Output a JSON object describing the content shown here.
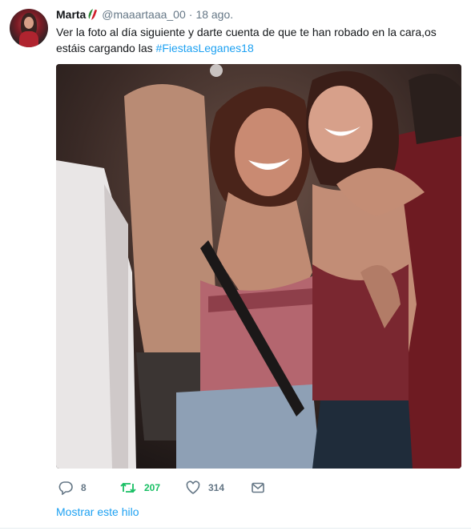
{
  "tweet": {
    "author_name": "Marta",
    "author_handle": "@maaartaaa_00",
    "separator": "·",
    "timestamp": "18 ago.",
    "text_line1": "Ver la foto al día siguiente y darte cuenta de que te han robado en la cara,os",
    "text_line2_prefix": "estáis cargando las ",
    "hashtag": "#FiestasLeganes18",
    "media": {
      "description_icon": "photo"
    },
    "actions": {
      "reply_count": "8",
      "retweet_count": "207",
      "like_count": "314"
    },
    "show_thread": "Mostrar este hilo"
  },
  "colors": {
    "link": "#1da1f2",
    "retweet": "#17bf63",
    "muted": "#657786"
  }
}
